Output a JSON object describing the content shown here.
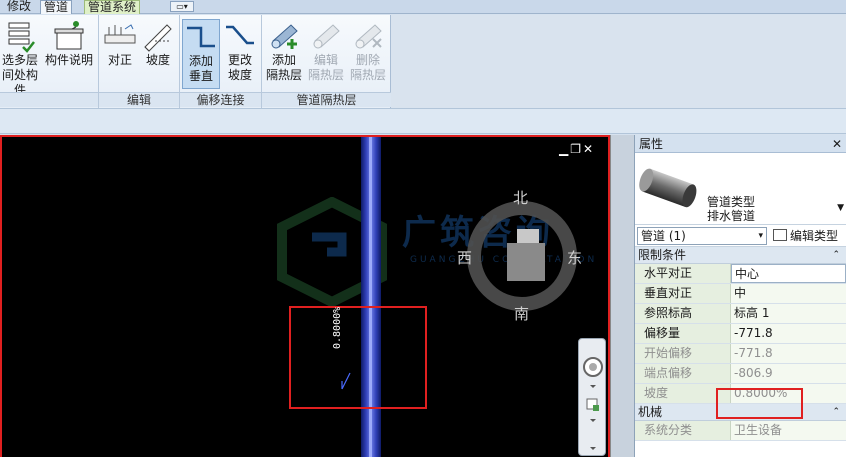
{
  "tabs": [
    {
      "label": "修改"
    },
    {
      "label": "管道"
    },
    {
      "label": "管道系统"
    }
  ],
  "ribbon": {
    "select_multi": {
      "line1": "选多层",
      "line2": "间处构件"
    },
    "component_desc": "构件说明",
    "align": "对正",
    "slope": "坡度",
    "add_vertical": {
      "line1": "添加",
      "line2": "垂直"
    },
    "change_slope": {
      "line1": "更改",
      "line2": "坡度"
    },
    "add_insulation": {
      "line1": "添加",
      "line2": "隔热层"
    },
    "edit_insulation": {
      "line1": "编辑",
      "line2": "隔热层"
    },
    "delete_insulation": {
      "line1": "删除",
      "line2": "隔热层"
    },
    "panels": {
      "edit": "编辑",
      "offset": "偏移连接",
      "insulation": "管道隔热层"
    }
  },
  "view": {
    "slope_label": "0.8000%",
    "compass": {
      "north": "北",
      "south": "南",
      "east": "东",
      "west": "西"
    },
    "watermark": {
      "text": "广筑咨询",
      "sub": "GUANGZHU CONSULTATION"
    }
  },
  "properties": {
    "title": "属性",
    "type_family": "管道类型",
    "type_name": "排水管道",
    "selector": "管道 (1)",
    "edit_type": "编辑类型",
    "groups": {
      "constraints": "限制条件",
      "mechanical": "机械"
    },
    "rows": [
      {
        "key": "水平对正",
        "value": "中心"
      },
      {
        "key": "垂直对正",
        "value": "中"
      },
      {
        "key": "参照标高",
        "value": "标高 1"
      },
      {
        "key": "偏移量",
        "value": "-771.8"
      },
      {
        "key": "开始偏移",
        "value": "-771.8"
      },
      {
        "key": "端点偏移",
        "value": "-806.9"
      },
      {
        "key": "坡度",
        "value": "0.8000%"
      }
    ],
    "mech_rows": [
      {
        "key": "系统分类",
        "value": "卫生设备"
      }
    ]
  },
  "colors": {
    "accent_red": "#e02020",
    "pipe_blue": "#3040b8"
  }
}
